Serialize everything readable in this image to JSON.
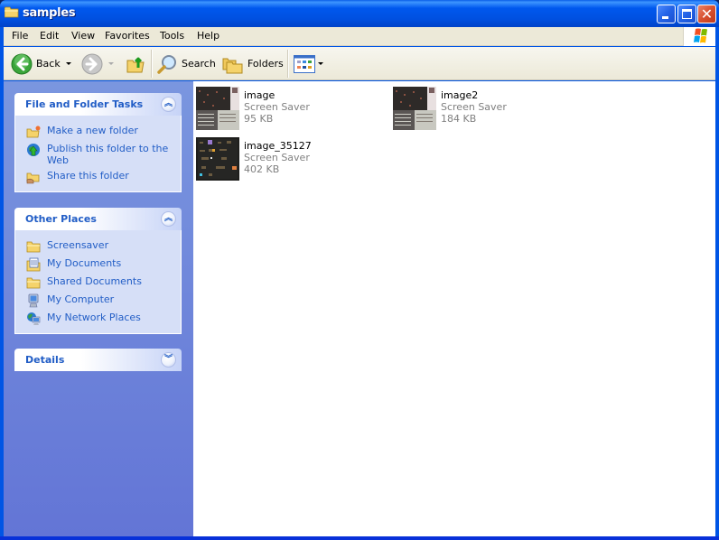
{
  "window": {
    "title": "samples",
    "controls": {
      "minimize": "minimize",
      "maximize": "maximize",
      "close": "close"
    }
  },
  "menubar": {
    "items": [
      "File",
      "Edit",
      "View",
      "Favorites",
      "Tools",
      "Help"
    ]
  },
  "toolbar": {
    "back_label": "Back",
    "search_label": "Search",
    "folders_label": "Folders"
  },
  "taskpane": {
    "file_tasks": {
      "title": "File and Folder Tasks",
      "collapse_glyph": "⌃",
      "items": [
        {
          "label": "Make a new folder",
          "icon": "new-folder-icon"
        },
        {
          "label": "Publish this folder to the Web",
          "icon": "publish-web-icon"
        },
        {
          "label": "Share this folder",
          "icon": "share-folder-icon"
        }
      ]
    },
    "other_places": {
      "title": "Other Places",
      "items": [
        {
          "label": "Screensaver",
          "icon": "folder-icon"
        },
        {
          "label": "My Documents",
          "icon": "my-documents-icon"
        },
        {
          "label": "Shared Documents",
          "icon": "folder-icon"
        },
        {
          "label": "My Computer",
          "icon": "my-computer-icon"
        },
        {
          "label": "My Network Places",
          "icon": "network-places-icon"
        }
      ]
    },
    "details": {
      "title": "Details"
    }
  },
  "files": [
    {
      "name": "image",
      "type": "Screen Saver",
      "size": "95 KB"
    },
    {
      "name": "image2",
      "type": "Screen Saver",
      "size": "184 KB"
    },
    {
      "name": "image_35127",
      "type": "Screen Saver",
      "size": "402 KB"
    }
  ],
  "colors": {
    "titlebar": "#0058ee",
    "link": "#215dc6",
    "taskpane_top": "#7a96df",
    "taskpane_bottom": "#6375d6",
    "panel_body": "#d6dff7"
  }
}
